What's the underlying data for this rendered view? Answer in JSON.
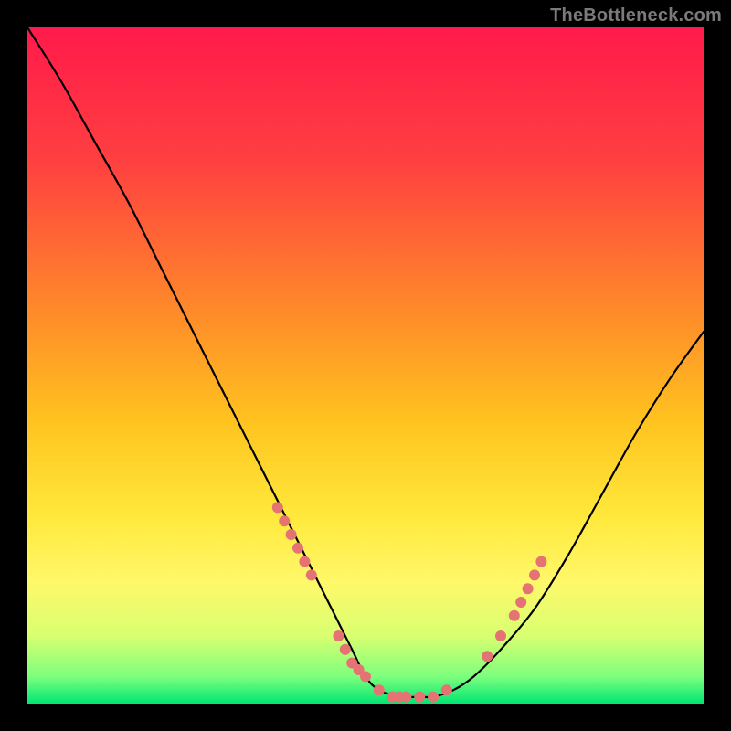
{
  "watermark": "TheBottleneck.com",
  "chart_data": {
    "type": "line",
    "title": "",
    "xlabel": "",
    "ylabel": "",
    "xlim": [
      0,
      100
    ],
    "ylim": [
      0,
      100
    ],
    "grid": false,
    "legend": false,
    "background_gradient_stops": [
      {
        "offset": 0.0,
        "color": "#ff1a4b"
      },
      {
        "offset": 0.2,
        "color": "#ff4040"
      },
      {
        "offset": 0.42,
        "color": "#ff8a2a"
      },
      {
        "offset": 0.58,
        "color": "#ffc21f"
      },
      {
        "offset": 0.72,
        "color": "#ffe83a"
      },
      {
        "offset": 0.82,
        "color": "#fff86a"
      },
      {
        "offset": 0.9,
        "color": "#d8ff70"
      },
      {
        "offset": 0.96,
        "color": "#7dff7d"
      },
      {
        "offset": 1.0,
        "color": "#00e673"
      }
    ],
    "series": [
      {
        "name": "bottleneck-curve",
        "color": "#000000",
        "x": [
          0,
          5,
          10,
          15,
          20,
          25,
          30,
          35,
          40,
          45,
          48,
          50,
          52,
          55,
          58,
          60,
          63,
          66,
          70,
          75,
          80,
          85,
          90,
          95,
          100
        ],
        "y": [
          100,
          92,
          83,
          74,
          64,
          54,
          44,
          34,
          24,
          14,
          8,
          4,
          2,
          1,
          1,
          1,
          2,
          4,
          8,
          14,
          22,
          31,
          40,
          48,
          55
        ]
      }
    ],
    "marker_groups": [
      {
        "name": "overlay-dots-left-slope",
        "color": "#e57373",
        "radius_px": 6,
        "points": [
          {
            "x": 37,
            "y": 29
          },
          {
            "x": 38,
            "y": 27
          },
          {
            "x": 39,
            "y": 25
          },
          {
            "x": 40,
            "y": 23
          },
          {
            "x": 41,
            "y": 21
          },
          {
            "x": 42,
            "y": 19
          }
        ]
      },
      {
        "name": "overlay-dots-valley-left",
        "color": "#e57373",
        "radius_px": 6,
        "points": [
          {
            "x": 46,
            "y": 10
          },
          {
            "x": 47,
            "y": 8
          },
          {
            "x": 48,
            "y": 6
          },
          {
            "x": 49,
            "y": 5
          },
          {
            "x": 50,
            "y": 4
          }
        ]
      },
      {
        "name": "overlay-dots-valley-floor",
        "color": "#e57373",
        "radius_px": 6,
        "points": [
          {
            "x": 52,
            "y": 2
          },
          {
            "x": 54,
            "y": 1
          },
          {
            "x": 55,
            "y": 1
          },
          {
            "x": 56,
            "y": 1
          },
          {
            "x": 58,
            "y": 1
          },
          {
            "x": 60,
            "y": 1
          },
          {
            "x": 62,
            "y": 2
          }
        ]
      },
      {
        "name": "overlay-dots-right-slope",
        "color": "#e57373",
        "radius_px": 6,
        "points": [
          {
            "x": 68,
            "y": 7
          },
          {
            "x": 70,
            "y": 10
          },
          {
            "x": 72,
            "y": 13
          },
          {
            "x": 73,
            "y": 15
          },
          {
            "x": 74,
            "y": 17
          },
          {
            "x": 75,
            "y": 19
          },
          {
            "x": 76,
            "y": 21
          }
        ]
      }
    ]
  }
}
